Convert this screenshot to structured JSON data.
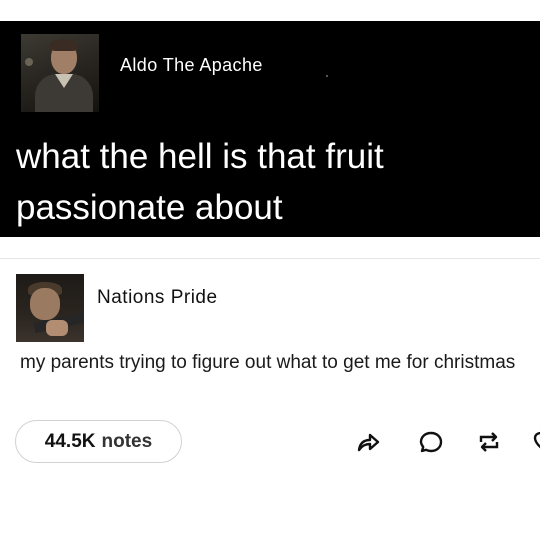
{
  "posts": [
    {
      "author": "Aldo The Apache",
      "text": "what the hell is that fruit passionate about"
    },
    {
      "author": "Nations Pride",
      "text": "my parents trying to figure out what to get me for christmas"
    }
  ],
  "footer": {
    "notes_count": "44.5K",
    "notes_label": "notes",
    "actions": [
      "share-icon",
      "reply-icon",
      "reblog-icon",
      "like-icon"
    ]
  },
  "colors": {
    "dark_post_bg": "#000000",
    "light_post_bg": "#ffffff",
    "pill_border": "#d2d2d2"
  }
}
